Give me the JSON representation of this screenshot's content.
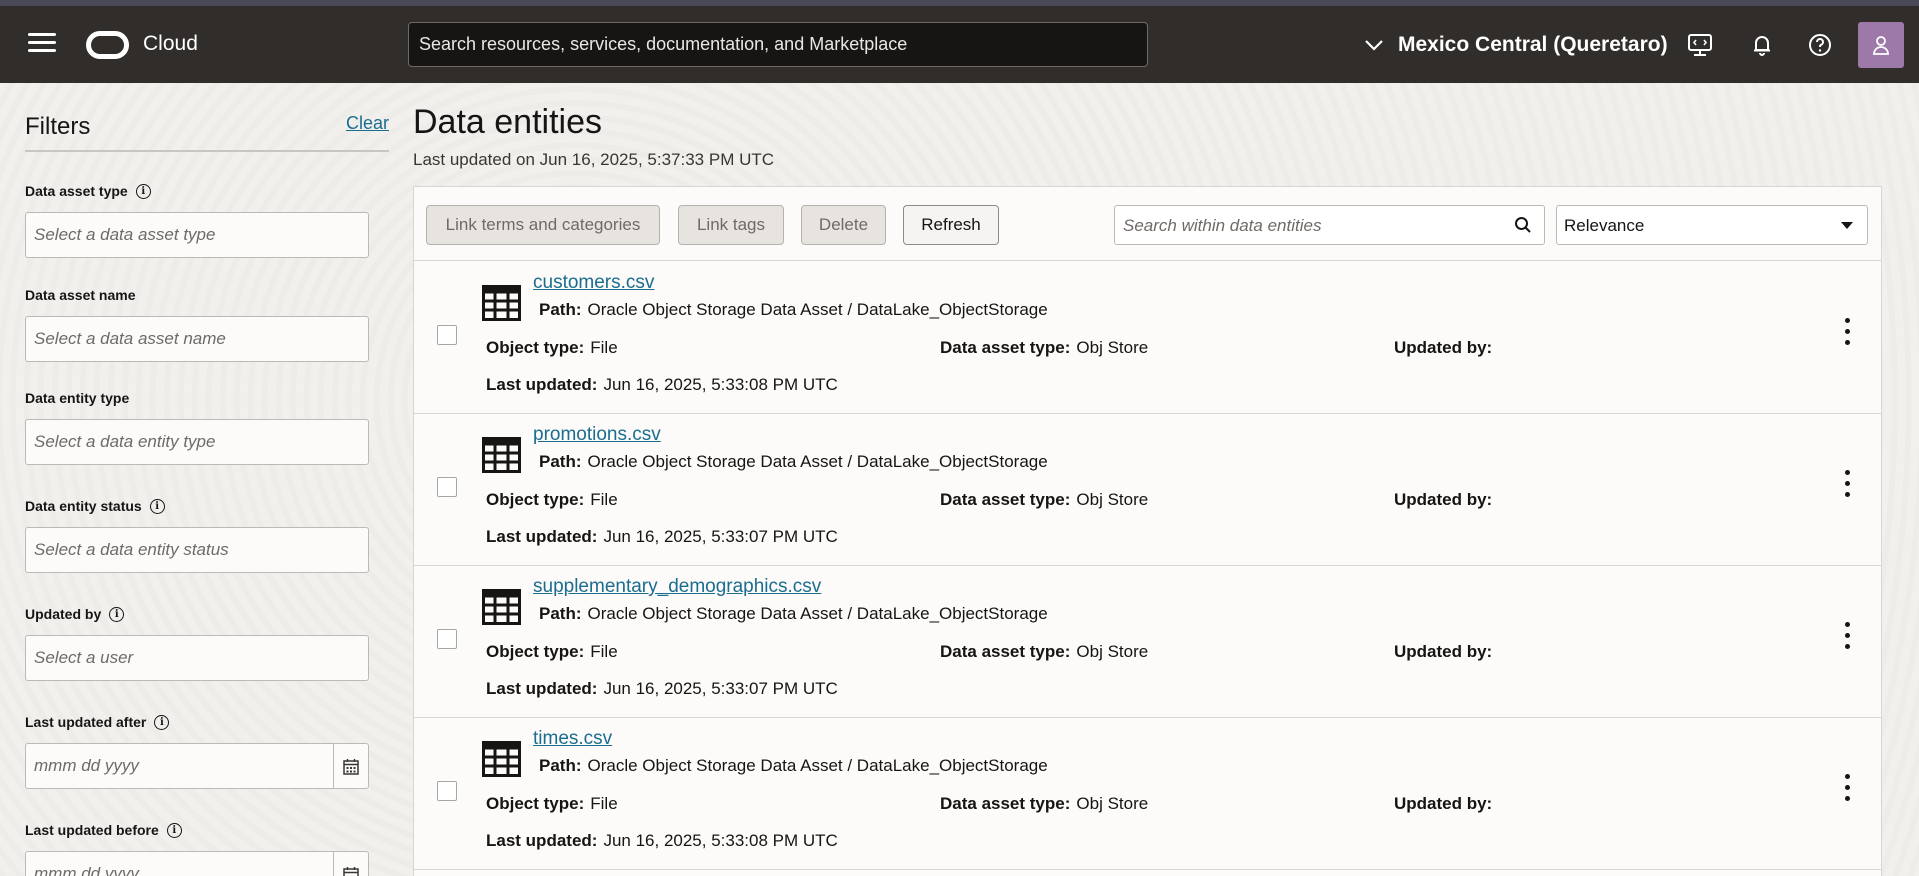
{
  "topbar": {
    "brand": "Cloud",
    "search_placeholder": "Search resources, services, documentation, and Marketplace",
    "region": "Mexico Central (Queretaro)"
  },
  "filters": {
    "title": "Filters",
    "clear": "Clear",
    "fields": [
      {
        "label": "Data asset type",
        "placeholder": "Select a data asset type",
        "info": true
      },
      {
        "label": "Data asset name",
        "placeholder": "Select a data asset name",
        "info": false
      },
      {
        "label": "Data entity type",
        "placeholder": "Select a data entity type",
        "info": false
      },
      {
        "label": "Data entity status",
        "placeholder": "Select a data entity status",
        "info": true
      },
      {
        "label": "Updated by",
        "placeholder": "Select a user",
        "info": true
      },
      {
        "label": "Last updated after",
        "placeholder": "mmm dd yyyy",
        "info": true
      },
      {
        "label": "Last updated before",
        "placeholder": "mmm dd yyyy",
        "info": true
      }
    ]
  },
  "main": {
    "title": "Data entities",
    "last_updated": "Last updated on Jun 16, 2025, 5:37:33 PM UTC",
    "toolbar": {
      "link_terms": "Link terms and categories",
      "link_tags": "Link tags",
      "delete": "Delete",
      "refresh": "Refresh",
      "search_placeholder": "Search within data entities",
      "sort": "Relevance"
    },
    "labels": {
      "path": "Path:",
      "object_type": "Object type:",
      "data_asset_type": "Data asset type:",
      "updated_by": "Updated by:",
      "last_updated": "Last updated:"
    },
    "entities": [
      {
        "name": "customers.csv",
        "path": "Oracle Object Storage Data Asset / DataLake_ObjectStorage",
        "object_type": "File",
        "data_asset_type": "Obj Store",
        "updated_by": "",
        "last_updated": "Jun 16, 2025, 5:33:08 PM UTC"
      },
      {
        "name": "promotions.csv",
        "path": "Oracle Object Storage Data Asset / DataLake_ObjectStorage",
        "object_type": "File",
        "data_asset_type": "Obj Store",
        "updated_by": "",
        "last_updated": "Jun 16, 2025, 5:33:07 PM UTC"
      },
      {
        "name": "supplementary_demographics.csv",
        "path": "Oracle Object Storage Data Asset / DataLake_ObjectStorage",
        "object_type": "File",
        "data_asset_type": "Obj Store",
        "updated_by": "",
        "last_updated": "Jun 16, 2025, 5:33:07 PM UTC"
      },
      {
        "name": "times.csv",
        "path": "Oracle Object Storage Data Asset / DataLake_ObjectStorage",
        "object_type": "File",
        "data_asset_type": "Obj Store",
        "updated_by": "",
        "last_updated": "Jun 16, 2025, 5:33:08 PM UTC"
      }
    ]
  },
  "icons": [
    "hamburger-icon",
    "cloud-logo-icon",
    "chevron-down-icon",
    "cloud-shell-icon",
    "bell-icon",
    "help-icon",
    "user-icon",
    "info-icon",
    "calendar-icon",
    "search-icon",
    "table-icon",
    "kebab-menu-icon"
  ],
  "colors": {
    "topbar": "#312d2a",
    "link": "#1b6d8f",
    "avatar": "#9c79a8"
  }
}
